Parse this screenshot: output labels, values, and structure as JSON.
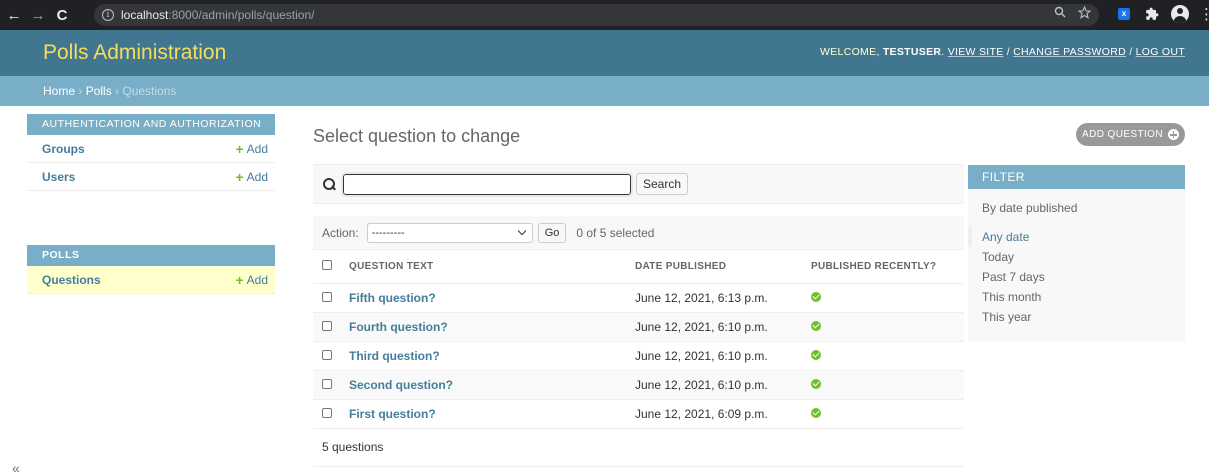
{
  "browser": {
    "back": "←",
    "forward": "→",
    "reload": "C",
    "info": "i",
    "url_host": "localhost",
    "url_rest": ":8000/admin/polls/question/",
    "ext_badge": "x"
  },
  "header": {
    "branding": "Polls Administration",
    "welcome": "WELCOME, ",
    "username": "TESTUSER",
    "view_site": "VIEW SITE",
    "change_password": "CHANGE PASSWORD",
    "log_out": "LOG OUT",
    "sep": " / "
  },
  "breadcrumbs": {
    "home": "Home",
    "polls": "Polls",
    "current": "Questions",
    "sep": " › "
  },
  "sidebar": {
    "modules": [
      {
        "caption": "AUTHENTICATION AND AUTHORIZATION",
        "models": [
          {
            "name": "Groups",
            "add": "Add"
          },
          {
            "name": "Users",
            "add": "Add"
          }
        ]
      },
      {
        "caption": "POLLS",
        "models": [
          {
            "name": "Questions",
            "add": "Add"
          }
        ]
      }
    ],
    "collapse": "«"
  },
  "main": {
    "title": "Select question to change",
    "add_button": "ADD QUESTION",
    "search_button": "Search",
    "search_value": "",
    "action_label": "Action:",
    "action_selected": "---------",
    "go_button": "Go",
    "selected_count": "0 of 5 selected",
    "columns": [
      "QUESTION TEXT",
      "DATE PUBLISHED",
      "PUBLISHED RECENTLY?"
    ],
    "rows": [
      {
        "question": "Fifth question?",
        "date": "June 12, 2021, 6:13 p.m."
      },
      {
        "question": "Fourth question?",
        "date": "June 12, 2021, 6:10 p.m."
      },
      {
        "question": "Third question?",
        "date": "June 12, 2021, 6:10 p.m."
      },
      {
        "question": "Second question?",
        "date": "June 12, 2021, 6:10 p.m."
      },
      {
        "question": "First question?",
        "date": "June 12, 2021, 6:09 p.m."
      }
    ],
    "paginator": "5 questions"
  },
  "filter": {
    "title": "FILTER",
    "heading": "By date published",
    "options": [
      "Any date",
      "Today",
      "Past 7 days",
      "This month",
      "This year"
    ]
  },
  "colors": {
    "header_bg": "#417690",
    "branding": "#f5dd5d",
    "breadcrumb_bg": "#79aec8",
    "link": "#447e9b",
    "add_green": "#70bf2b",
    "current_row": "#ffffcc"
  }
}
